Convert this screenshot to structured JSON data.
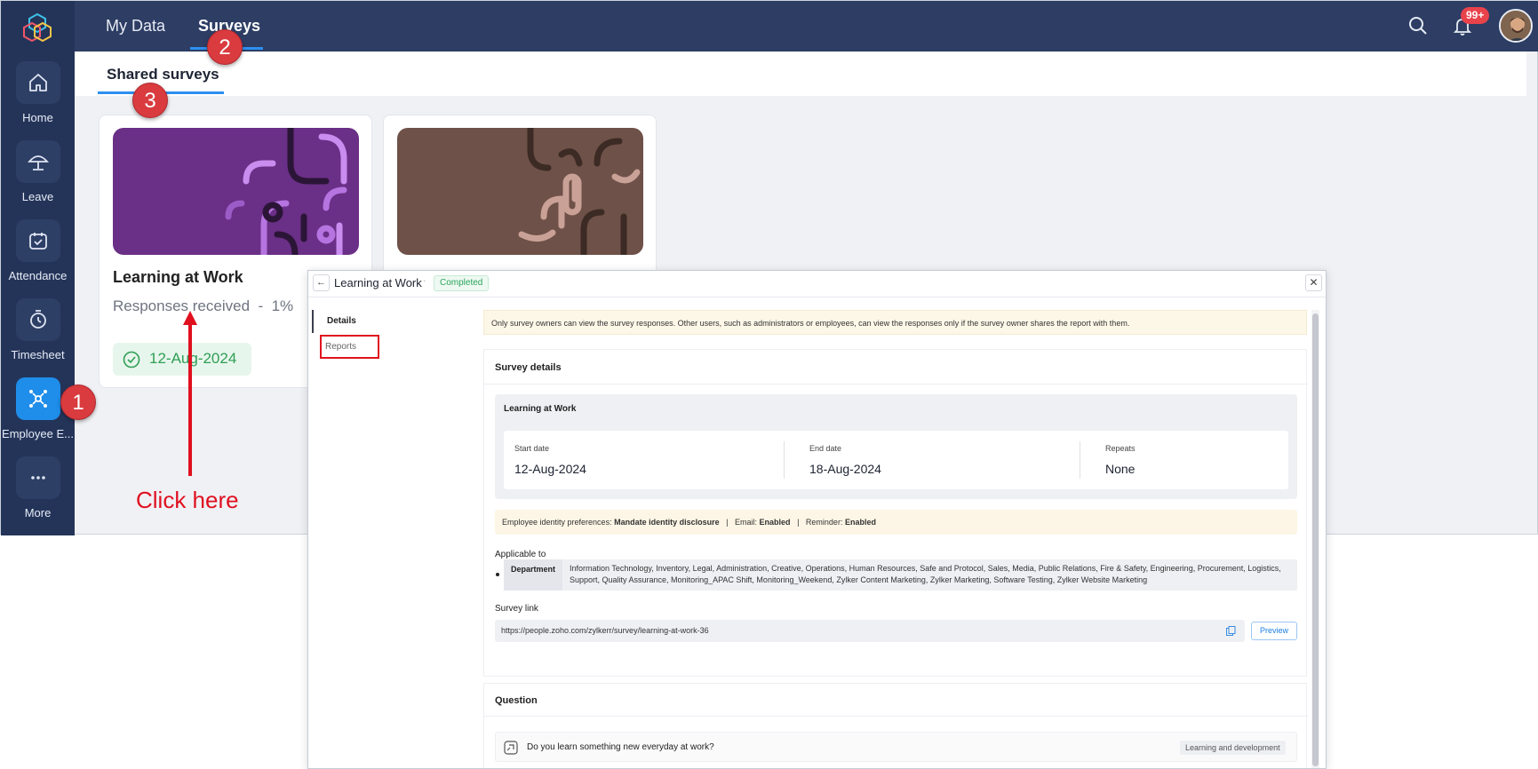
{
  "sidebar": {
    "items": [
      {
        "label": "Home",
        "icon": "home-icon"
      },
      {
        "label": "Leave",
        "icon": "umbrella-icon"
      },
      {
        "label": "Attendance",
        "icon": "calendar-check-icon"
      },
      {
        "label": "Timesheet",
        "icon": "stopwatch-icon"
      },
      {
        "label": "Employee E...",
        "icon": "engagement-icon"
      },
      {
        "label": "More",
        "icon": "more-icon"
      }
    ]
  },
  "topbar": {
    "tabs": [
      {
        "label": "My Data"
      },
      {
        "label": "Surveys"
      }
    ],
    "notification_count": "99+"
  },
  "subnav": {
    "tab": "Shared surveys"
  },
  "cards": [
    {
      "title": "Learning at Work",
      "responses_label": "Responses received",
      "responses_value": "1%",
      "date": "12-Aug-2024"
    }
  ],
  "steps": [
    "1",
    "2",
    "3"
  ],
  "annotation": {
    "text": "Click here"
  },
  "dialog": {
    "title": "Learning at Work",
    "separator": "·",
    "status": "Completed",
    "nav": [
      {
        "label": "Details"
      },
      {
        "label": "Reports"
      }
    ],
    "banner": "Only survey owners can view the survey responses. Other users, such as administrators or employees, can view the responses only if the survey owner shares the report with them.",
    "details": {
      "section_title": "Survey details",
      "survey_name": "Learning at Work",
      "start_label": "Start date",
      "start_value": "12-Aug-2024",
      "end_label": "End date",
      "end_value": "18-Aug-2024",
      "repeats_label": "Repeats",
      "repeats_value": "None",
      "prefs": {
        "identity_label": "Employee identity preferences:",
        "identity_value": "Mandate identity disclosure",
        "sep": "|",
        "email_label": "Email:",
        "email_value": "Enabled",
        "reminder_label": "Reminder:",
        "reminder_value": "Enabled"
      },
      "applicable_title": "Applicable to",
      "department_label": "Department",
      "department_value": "Information Technology, Inventory, Legal, Administration, Creative, Operations, Human Resources, Safe and Protocol, Sales, Media, Public Relations, Fire & Safety, Engineering, Procurement, Logistics, Support, Quality Assurance, Monitoring_APAC Shift, Monitoring_Weekend, Zylker Content Marketing, Zylker Marketing, Software Testing, Zylker Website Marketing",
      "link_title": "Survey link",
      "link_url": "https://people.zoho.com/zylkerr/survey/learning-at-work-36",
      "preview_label": "Preview"
    },
    "question": {
      "section_title": "Question",
      "text": "Do you learn something new everyday at work?",
      "tag": "Learning and development"
    }
  },
  "colors": {
    "accent": "#1f8dea",
    "sidebar": "#243459",
    "annotation": "#e0101f",
    "success": "#2f9e55"
  }
}
